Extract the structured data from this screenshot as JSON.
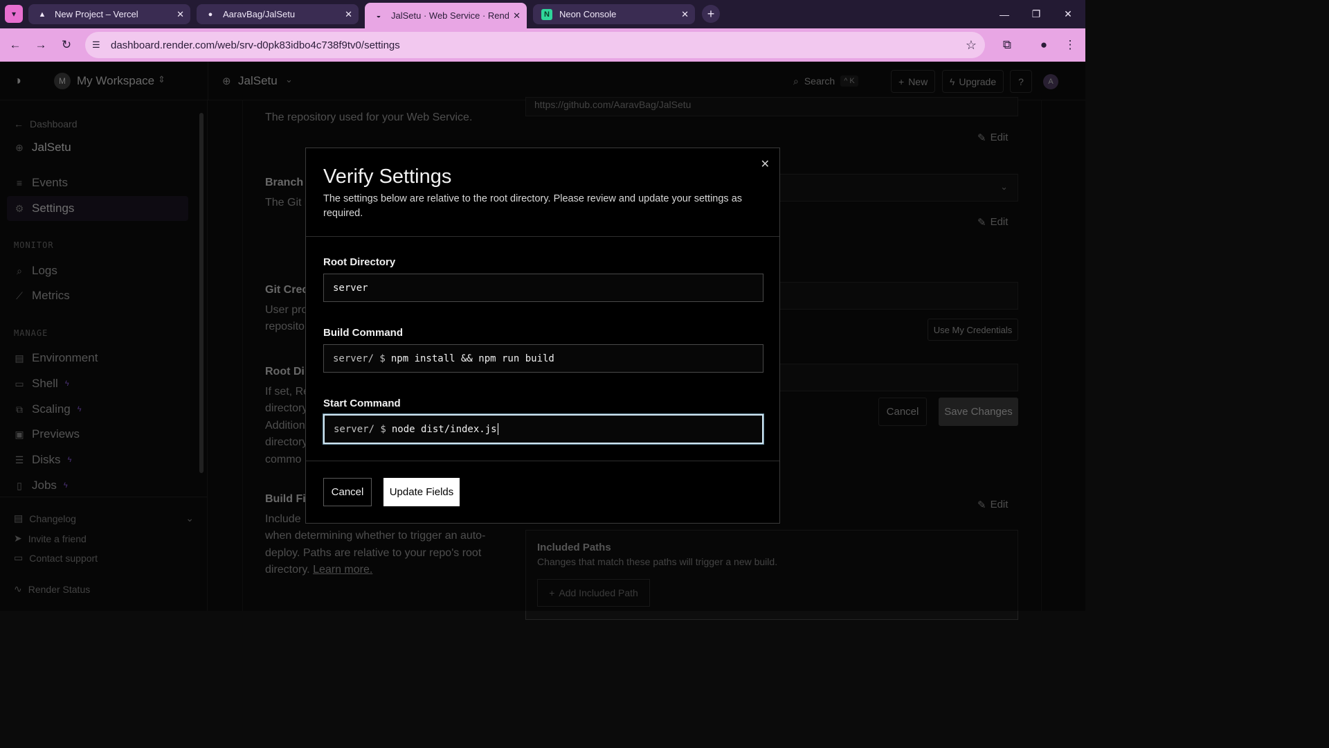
{
  "browser": {
    "tabs": [
      {
        "title": "New Project – Vercel",
        "icon": "vercel-triangle-icon"
      },
      {
        "title": "AaravBag/JalSetu",
        "icon": "github-icon"
      },
      {
        "title": "JalSetu · Web Service · Render",
        "icon": "render-logo-icon",
        "active": true
      },
      {
        "title": "Neon Console",
        "icon": "neon-logo-icon"
      }
    ],
    "url": "dashboard.render.com/web/srv-d0pk83idbo4c738f9tv0/settings",
    "accent_color": "#e8a6e4"
  },
  "header": {
    "workspace_initial": "M",
    "workspace_name": "My Workspace",
    "service_name": "JalSetu",
    "search_label": "Search",
    "search_shortcut": "^ K",
    "new_label": "New",
    "upgrade_label": "Upgrade",
    "user_initial": "A"
  },
  "sidebar": {
    "back_label": "Dashboard",
    "service_name": "JalSetu",
    "items_top": [
      {
        "label": "Events",
        "icon": "events-icon"
      },
      {
        "label": "Settings",
        "icon": "settings-gear-icon",
        "active": true
      }
    ],
    "monitor_heading": "MONITOR",
    "monitor_items": [
      {
        "label": "Logs",
        "icon": "logs-icon"
      },
      {
        "label": "Metrics",
        "icon": "metrics-icon"
      }
    ],
    "manage_heading": "MANAGE",
    "manage_items": [
      {
        "label": "Environment",
        "icon": "environment-icon"
      },
      {
        "label": "Shell",
        "icon": "shell-icon",
        "upgrade": true
      },
      {
        "label": "Scaling",
        "icon": "scaling-icon",
        "upgrade": true
      },
      {
        "label": "Previews",
        "icon": "previews-icon"
      },
      {
        "label": "Disks",
        "icon": "disks-icon",
        "upgrade": true
      },
      {
        "label": "Jobs",
        "icon": "jobs-icon",
        "upgrade": true
      }
    ],
    "footer_items": [
      {
        "label": "Changelog",
        "icon": "changelog-icon"
      },
      {
        "label": "Invite a friend",
        "icon": "invite-icon"
      },
      {
        "label": "Contact support",
        "icon": "support-icon"
      },
      {
        "label": "Render Status",
        "icon": "status-icon"
      }
    ]
  },
  "background": {
    "repo_desc": "The repository used for your Web Service.",
    "repo_url": "https://github.com/AaravBag/JalSetu",
    "branch_head": "Branch",
    "branch_desc": "The Git b",
    "gitcred_head": "Git Crec",
    "gitcred_desc_1": "User pro",
    "gitcred_desc_2": "reposito",
    "rootdir_head": "Root Dir",
    "rootdir_lines": [
      "If set, Re",
      "directory",
      "Additiona",
      "directory",
      "commo"
    ],
    "buildfilter_head": "Build Fil",
    "buildfilter_line1": "Include",
    "buildfilter_line2": "when determining whether to trigger an auto-",
    "buildfilter_line3": "deploy. Paths are relative to your repo's root",
    "buildfilter_line4": "directory.",
    "learn_more": "Learn more.",
    "edit_label": "Edit",
    "use_credentials": "Use My Credentials",
    "cancel_label": "Cancel",
    "save_label": "Save Changes",
    "included_paths_head": "Included Paths",
    "included_paths_desc": "Changes that match these paths will trigger a new build.",
    "add_included_path": "Add Included Path"
  },
  "modal": {
    "title": "Verify Settings",
    "description": "The settings below are relative to the root directory. Please review and update your settings as required.",
    "root_label": "Root Directory",
    "root_value": "server",
    "build_label": "Build Command",
    "build_prefix": "server/ $",
    "build_value": "npm install && npm run build",
    "start_label": "Start Command",
    "start_prefix": "server/ $",
    "start_value": "node dist/index.js",
    "cancel_label": "Cancel",
    "update_label": "Update Fields"
  }
}
